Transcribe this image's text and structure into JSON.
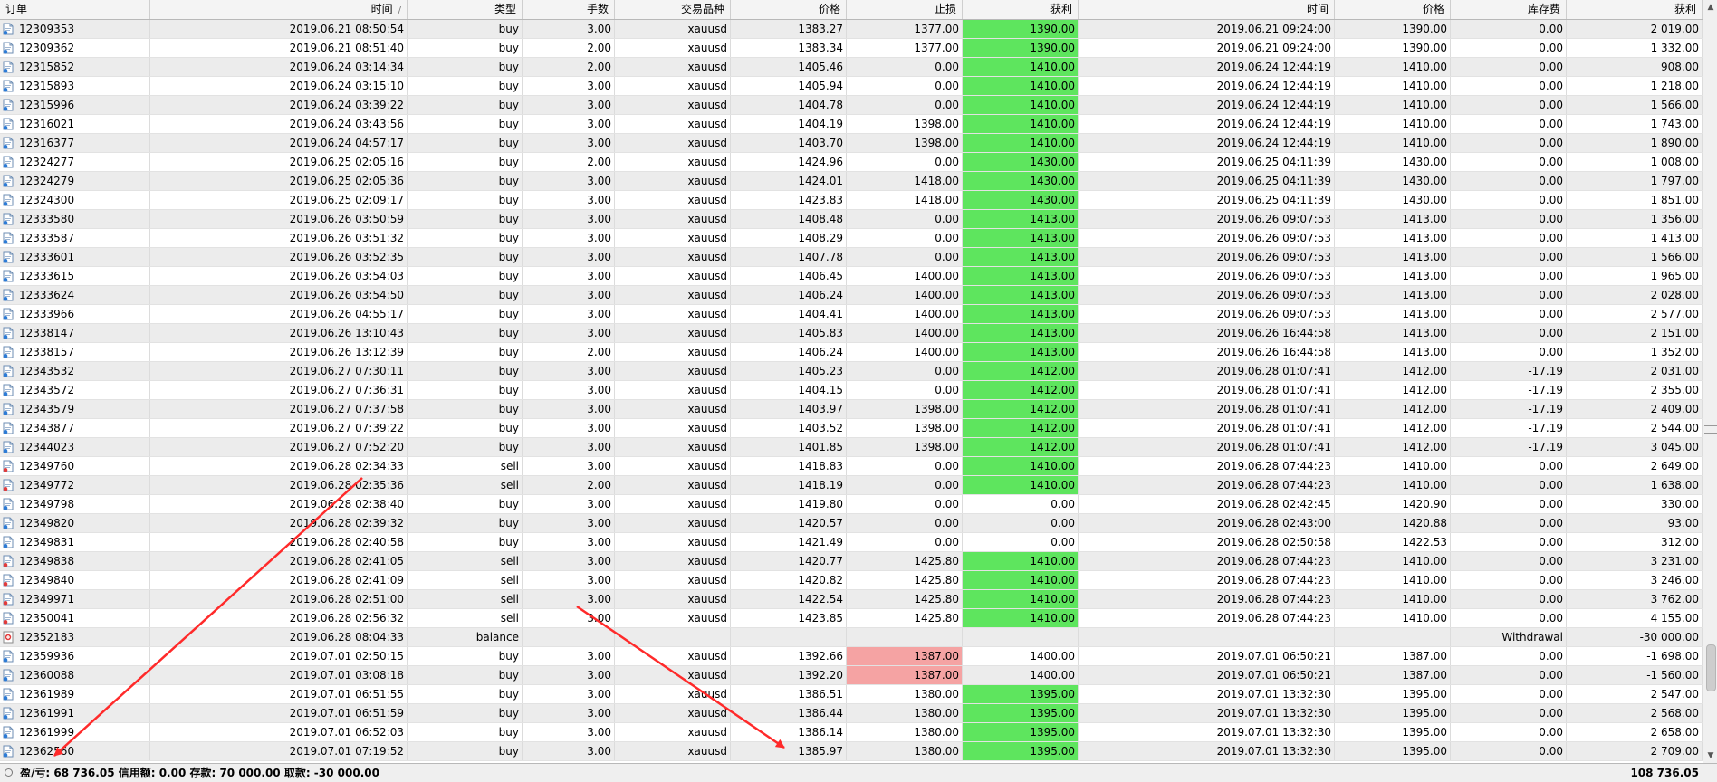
{
  "header": {
    "columns": [
      "订单",
      "时间",
      "类型",
      "手数",
      "交易品种",
      "价格",
      "止损",
      "获利",
      "时间",
      "价格",
      "库存费",
      "获利"
    ],
    "sort_mark": "/"
  },
  "icons": {
    "buy": "buy-ticket-icon",
    "sell": "sell-ticket-icon",
    "balance": "balance-ticket-icon"
  },
  "colors": {
    "take_profit_hit": "#5ee55e",
    "stop_loss_hit": "#f5a3a3",
    "arrow": "#ff2a2a"
  },
  "rows": [
    {
      "ticket": "12309353",
      "open_time": "2019.06.21 08:50:54",
      "type": "buy",
      "lots": "3.00",
      "symbol": "xauusd",
      "open_price": "1383.27",
      "sl": "1377.00",
      "tp": "1390.00",
      "close_time": "2019.06.21 09:24:00",
      "close_price": "1390.00",
      "swap": "0.00",
      "profit": "2 019.00",
      "hl": "tp"
    },
    {
      "ticket": "12309362",
      "open_time": "2019.06.21 08:51:40",
      "type": "buy",
      "lots": "2.00",
      "symbol": "xauusd",
      "open_price": "1383.34",
      "sl": "1377.00",
      "tp": "1390.00",
      "close_time": "2019.06.21 09:24:00",
      "close_price": "1390.00",
      "swap": "0.00",
      "profit": "1 332.00",
      "hl": "tp"
    },
    {
      "ticket": "12315852",
      "open_time": "2019.06.24 03:14:34",
      "type": "buy",
      "lots": "2.00",
      "symbol": "xauusd",
      "open_price": "1405.46",
      "sl": "0.00",
      "tp": "1410.00",
      "close_time": "2019.06.24 12:44:19",
      "close_price": "1410.00",
      "swap": "0.00",
      "profit": "908.00",
      "hl": "tp"
    },
    {
      "ticket": "12315893",
      "open_time": "2019.06.24 03:15:10",
      "type": "buy",
      "lots": "3.00",
      "symbol": "xauusd",
      "open_price": "1405.94",
      "sl": "0.00",
      "tp": "1410.00",
      "close_time": "2019.06.24 12:44:19",
      "close_price": "1410.00",
      "swap": "0.00",
      "profit": "1 218.00",
      "hl": "tp"
    },
    {
      "ticket": "12315996",
      "open_time": "2019.06.24 03:39:22",
      "type": "buy",
      "lots": "3.00",
      "symbol": "xauusd",
      "open_price": "1404.78",
      "sl": "0.00",
      "tp": "1410.00",
      "close_time": "2019.06.24 12:44:19",
      "close_price": "1410.00",
      "swap": "0.00",
      "profit": "1 566.00",
      "hl": "tp"
    },
    {
      "ticket": "12316021",
      "open_time": "2019.06.24 03:43:56",
      "type": "buy",
      "lots": "3.00",
      "symbol": "xauusd",
      "open_price": "1404.19",
      "sl": "1398.00",
      "tp": "1410.00",
      "close_time": "2019.06.24 12:44:19",
      "close_price": "1410.00",
      "swap": "0.00",
      "profit": "1 743.00",
      "hl": "tp"
    },
    {
      "ticket": "12316377",
      "open_time": "2019.06.24 04:57:17",
      "type": "buy",
      "lots": "3.00",
      "symbol": "xauusd",
      "open_price": "1403.70",
      "sl": "1398.00",
      "tp": "1410.00",
      "close_time": "2019.06.24 12:44:19",
      "close_price": "1410.00",
      "swap": "0.00",
      "profit": "1 890.00",
      "hl": "tp"
    },
    {
      "ticket": "12324277",
      "open_time": "2019.06.25 02:05:16",
      "type": "buy",
      "lots": "2.00",
      "symbol": "xauusd",
      "open_price": "1424.96",
      "sl": "0.00",
      "tp": "1430.00",
      "close_time": "2019.06.25 04:11:39",
      "close_price": "1430.00",
      "swap": "0.00",
      "profit": "1 008.00",
      "hl": "tp"
    },
    {
      "ticket": "12324279",
      "open_time": "2019.06.25 02:05:36",
      "type": "buy",
      "lots": "3.00",
      "symbol": "xauusd",
      "open_price": "1424.01",
      "sl": "1418.00",
      "tp": "1430.00",
      "close_time": "2019.06.25 04:11:39",
      "close_price": "1430.00",
      "swap": "0.00",
      "profit": "1 797.00",
      "hl": "tp"
    },
    {
      "ticket": "12324300",
      "open_time": "2019.06.25 02:09:17",
      "type": "buy",
      "lots": "3.00",
      "symbol": "xauusd",
      "open_price": "1423.83",
      "sl": "1418.00",
      "tp": "1430.00",
      "close_time": "2019.06.25 04:11:39",
      "close_price": "1430.00",
      "swap": "0.00",
      "profit": "1 851.00",
      "hl": "tp"
    },
    {
      "ticket": "12333580",
      "open_time": "2019.06.26 03:50:59",
      "type": "buy",
      "lots": "3.00",
      "symbol": "xauusd",
      "open_price": "1408.48",
      "sl": "0.00",
      "tp": "1413.00",
      "close_time": "2019.06.26 09:07:53",
      "close_price": "1413.00",
      "swap": "0.00",
      "profit": "1 356.00",
      "hl": "tp"
    },
    {
      "ticket": "12333587",
      "open_time": "2019.06.26 03:51:32",
      "type": "buy",
      "lots": "3.00",
      "symbol": "xauusd",
      "open_price": "1408.29",
      "sl": "0.00",
      "tp": "1413.00",
      "close_time": "2019.06.26 09:07:53",
      "close_price": "1413.00",
      "swap": "0.00",
      "profit": "1 413.00",
      "hl": "tp"
    },
    {
      "ticket": "12333601",
      "open_time": "2019.06.26 03:52:35",
      "type": "buy",
      "lots": "3.00",
      "symbol": "xauusd",
      "open_price": "1407.78",
      "sl": "0.00",
      "tp": "1413.00",
      "close_time": "2019.06.26 09:07:53",
      "close_price": "1413.00",
      "swap": "0.00",
      "profit": "1 566.00",
      "hl": "tp"
    },
    {
      "ticket": "12333615",
      "open_time": "2019.06.26 03:54:03",
      "type": "buy",
      "lots": "3.00",
      "symbol": "xauusd",
      "open_price": "1406.45",
      "sl": "1400.00",
      "tp": "1413.00",
      "close_time": "2019.06.26 09:07:53",
      "close_price": "1413.00",
      "swap": "0.00",
      "profit": "1 965.00",
      "hl": "tp"
    },
    {
      "ticket": "12333624",
      "open_time": "2019.06.26 03:54:50",
      "type": "buy",
      "lots": "3.00",
      "symbol": "xauusd",
      "open_price": "1406.24",
      "sl": "1400.00",
      "tp": "1413.00",
      "close_time": "2019.06.26 09:07:53",
      "close_price": "1413.00",
      "swap": "0.00",
      "profit": "2 028.00",
      "hl": "tp"
    },
    {
      "ticket": "12333966",
      "open_time": "2019.06.26 04:55:17",
      "type": "buy",
      "lots": "3.00",
      "symbol": "xauusd",
      "open_price": "1404.41",
      "sl": "1400.00",
      "tp": "1413.00",
      "close_time": "2019.06.26 09:07:53",
      "close_price": "1413.00",
      "swap": "0.00",
      "profit": "2 577.00",
      "hl": "tp"
    },
    {
      "ticket": "12338147",
      "open_time": "2019.06.26 13:10:43",
      "type": "buy",
      "lots": "3.00",
      "symbol": "xauusd",
      "open_price": "1405.83",
      "sl": "1400.00",
      "tp": "1413.00",
      "close_time": "2019.06.26 16:44:58",
      "close_price": "1413.00",
      "swap": "0.00",
      "profit": "2 151.00",
      "hl": "tp"
    },
    {
      "ticket": "12338157",
      "open_time": "2019.06.26 13:12:39",
      "type": "buy",
      "lots": "2.00",
      "symbol": "xauusd",
      "open_price": "1406.24",
      "sl": "1400.00",
      "tp": "1413.00",
      "close_time": "2019.06.26 16:44:58",
      "close_price": "1413.00",
      "swap": "0.00",
      "profit": "1 352.00",
      "hl": "tp"
    },
    {
      "ticket": "12343532",
      "open_time": "2019.06.27 07:30:11",
      "type": "buy",
      "lots": "3.00",
      "symbol": "xauusd",
      "open_price": "1405.23",
      "sl": "0.00",
      "tp": "1412.00",
      "close_time": "2019.06.28 01:07:41",
      "close_price": "1412.00",
      "swap": "-17.19",
      "profit": "2 031.00",
      "hl": "tp"
    },
    {
      "ticket": "12343572",
      "open_time": "2019.06.27 07:36:31",
      "type": "buy",
      "lots": "3.00",
      "symbol": "xauusd",
      "open_price": "1404.15",
      "sl": "0.00",
      "tp": "1412.00",
      "close_time": "2019.06.28 01:07:41",
      "close_price": "1412.00",
      "swap": "-17.19",
      "profit": "2 355.00",
      "hl": "tp"
    },
    {
      "ticket": "12343579",
      "open_time": "2019.06.27 07:37:58",
      "type": "buy",
      "lots": "3.00",
      "symbol": "xauusd",
      "open_price": "1403.97",
      "sl": "1398.00",
      "tp": "1412.00",
      "close_time": "2019.06.28 01:07:41",
      "close_price": "1412.00",
      "swap": "-17.19",
      "profit": "2 409.00",
      "hl": "tp"
    },
    {
      "ticket": "12343877",
      "open_time": "2019.06.27 07:39:22",
      "type": "buy",
      "lots": "3.00",
      "symbol": "xauusd",
      "open_price": "1403.52",
      "sl": "1398.00",
      "tp": "1412.00",
      "close_time": "2019.06.28 01:07:41",
      "close_price": "1412.00",
      "swap": "-17.19",
      "profit": "2 544.00",
      "hl": "tp"
    },
    {
      "ticket": "12344023",
      "open_time": "2019.06.27 07:52:20",
      "type": "buy",
      "lots": "3.00",
      "symbol": "xauusd",
      "open_price": "1401.85",
      "sl": "1398.00",
      "tp": "1412.00",
      "close_time": "2019.06.28 01:07:41",
      "close_price": "1412.00",
      "swap": "-17.19",
      "profit": "3 045.00",
      "hl": "tp"
    },
    {
      "ticket": "12349760",
      "open_time": "2019.06.28 02:34:33",
      "type": "sell",
      "lots": "3.00",
      "symbol": "xauusd",
      "open_price": "1418.83",
      "sl": "0.00",
      "tp": "1410.00",
      "close_time": "2019.06.28 07:44:23",
      "close_price": "1410.00",
      "swap": "0.00",
      "profit": "2 649.00",
      "hl": "tp"
    },
    {
      "ticket": "12349772",
      "open_time": "2019.06.28 02:35:36",
      "type": "sell",
      "lots": "2.00",
      "symbol": "xauusd",
      "open_price": "1418.19",
      "sl": "0.00",
      "tp": "1410.00",
      "close_time": "2019.06.28 07:44:23",
      "close_price": "1410.00",
      "swap": "0.00",
      "profit": "1 638.00",
      "hl": "tp"
    },
    {
      "ticket": "12349798",
      "open_time": "2019.06.28 02:38:40",
      "type": "buy",
      "lots": "3.00",
      "symbol": "xauusd",
      "open_price": "1419.80",
      "sl": "0.00",
      "tp": "0.00",
      "close_time": "2019.06.28 02:42:45",
      "close_price": "1420.90",
      "swap": "0.00",
      "profit": "330.00",
      "hl": ""
    },
    {
      "ticket": "12349820",
      "open_time": "2019.06.28 02:39:32",
      "type": "buy",
      "lots": "3.00",
      "symbol": "xauusd",
      "open_price": "1420.57",
      "sl": "0.00",
      "tp": "0.00",
      "close_time": "2019.06.28 02:43:00",
      "close_price": "1420.88",
      "swap": "0.00",
      "profit": "93.00",
      "hl": ""
    },
    {
      "ticket": "12349831",
      "open_time": "2019.06.28 02:40:58",
      "type": "buy",
      "lots": "3.00",
      "symbol": "xauusd",
      "open_price": "1421.49",
      "sl": "0.00",
      "tp": "0.00",
      "close_time": "2019.06.28 02:50:58",
      "close_price": "1422.53",
      "swap": "0.00",
      "profit": "312.00",
      "hl": ""
    },
    {
      "ticket": "12349838",
      "open_time": "2019.06.28 02:41:05",
      "type": "sell",
      "lots": "3.00",
      "symbol": "xauusd",
      "open_price": "1420.77",
      "sl": "1425.80",
      "tp": "1410.00",
      "close_time": "2019.06.28 07:44:23",
      "close_price": "1410.00",
      "swap": "0.00",
      "profit": "3 231.00",
      "hl": "tp"
    },
    {
      "ticket": "12349840",
      "open_time": "2019.06.28 02:41:09",
      "type": "sell",
      "lots": "3.00",
      "symbol": "xauusd",
      "open_price": "1420.82",
      "sl": "1425.80",
      "tp": "1410.00",
      "close_time": "2019.06.28 07:44:23",
      "close_price": "1410.00",
      "swap": "0.00",
      "profit": "3 246.00",
      "hl": "tp"
    },
    {
      "ticket": "12349971",
      "open_time": "2019.06.28 02:51:00",
      "type": "sell",
      "lots": "3.00",
      "symbol": "xauusd",
      "open_price": "1422.54",
      "sl": "1425.80",
      "tp": "1410.00",
      "close_time": "2019.06.28 07:44:23",
      "close_price": "1410.00",
      "swap": "0.00",
      "profit": "3 762.00",
      "hl": "tp"
    },
    {
      "ticket": "12350041",
      "open_time": "2019.06.28 02:56:32",
      "type": "sell",
      "lots": "3.00",
      "symbol": "xauusd",
      "open_price": "1423.85",
      "sl": "1425.80",
      "tp": "1410.00",
      "close_time": "2019.06.28 07:44:23",
      "close_price": "1410.00",
      "swap": "0.00",
      "profit": "4 155.00",
      "hl": "tp"
    },
    {
      "ticket": "12352183",
      "open_time": "2019.06.28 08:04:33",
      "type": "balance",
      "lots": "",
      "symbol": "",
      "open_price": "",
      "sl": "",
      "tp": "",
      "close_time": "",
      "close_price": "",
      "swap": "Withdrawal",
      "profit": "-30 000.00",
      "hl": ""
    },
    {
      "ticket": "12359936",
      "open_time": "2019.07.01 02:50:15",
      "type": "buy",
      "lots": "3.00",
      "symbol": "xauusd",
      "open_price": "1392.66",
      "sl": "1387.00",
      "tp": "1400.00",
      "close_time": "2019.07.01 06:50:21",
      "close_price": "1387.00",
      "swap": "0.00",
      "profit": "-1 698.00",
      "hl": "sl"
    },
    {
      "ticket": "12360088",
      "open_time": "2019.07.01 03:08:18",
      "type": "buy",
      "lots": "3.00",
      "symbol": "xauusd",
      "open_price": "1392.20",
      "sl": "1387.00",
      "tp": "1400.00",
      "close_time": "2019.07.01 06:50:21",
      "close_price": "1387.00",
      "swap": "0.00",
      "profit": "-1 560.00",
      "hl": "sl"
    },
    {
      "ticket": "12361989",
      "open_time": "2019.07.01 06:51:55",
      "type": "buy",
      "lots": "3.00",
      "symbol": "xauusd",
      "open_price": "1386.51",
      "sl": "1380.00",
      "tp": "1395.00",
      "close_time": "2019.07.01 13:32:30",
      "close_price": "1395.00",
      "swap": "0.00",
      "profit": "2 547.00",
      "hl": "tp"
    },
    {
      "ticket": "12361991",
      "open_time": "2019.07.01 06:51:59",
      "type": "buy",
      "lots": "3.00",
      "symbol": "xauusd",
      "open_price": "1386.44",
      "sl": "1380.00",
      "tp": "1395.00",
      "close_time": "2019.07.01 13:32:30",
      "close_price": "1395.00",
      "swap": "0.00",
      "profit": "2 568.00",
      "hl": "tp"
    },
    {
      "ticket": "12361999",
      "open_time": "2019.07.01 06:52:03",
      "type": "buy",
      "lots": "3.00",
      "symbol": "xauusd",
      "open_price": "1386.14",
      "sl": "1380.00",
      "tp": "1395.00",
      "close_time": "2019.07.01 13:32:30",
      "close_price": "1395.00",
      "swap": "0.00",
      "profit": "2 658.00",
      "hl": "tp"
    },
    {
      "ticket": "12362560",
      "open_time": "2019.07.01 07:19:52",
      "type": "buy",
      "lots": "3.00",
      "symbol": "xauusd",
      "open_price": "1385.97",
      "sl": "1380.00",
      "tp": "1395.00",
      "close_time": "2019.07.01 13:32:30",
      "close_price": "1395.00",
      "swap": "0.00",
      "profit": "2 709.00",
      "hl": "tp"
    }
  ],
  "status_bar": {
    "summary": "盈/亏: 68 736.05  信用额: 0.00  存款: 70 000.00  取款: -30 000.00",
    "total": "108 736.05"
  }
}
